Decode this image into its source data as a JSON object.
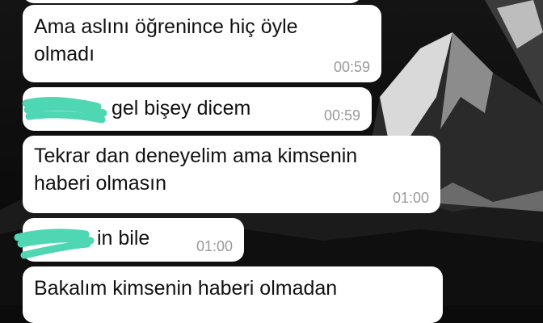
{
  "background": {
    "scene": "dark mountain wallpaper",
    "bubble_color": "#ffffff",
    "time_color": "#9a9a9a",
    "scribble_color": "#4fd6b3"
  },
  "messages": [
    {
      "line1": "Ama aslını öğrenince hiç öyle",
      "line2": "olmadı",
      "time": "00:59"
    },
    {
      "text": "gel bişey dicem",
      "time": "00:59",
      "redacted_prefix": true
    },
    {
      "line1": "Tekrar dan deneyelim ama kimsenin",
      "line2": "haberi olmasın",
      "time": "01:00"
    },
    {
      "text": "in bile",
      "time": "01:00",
      "redacted_prefix": true
    },
    {
      "line1": "Bakalım kimsenin haberi olmadan"
    }
  ]
}
